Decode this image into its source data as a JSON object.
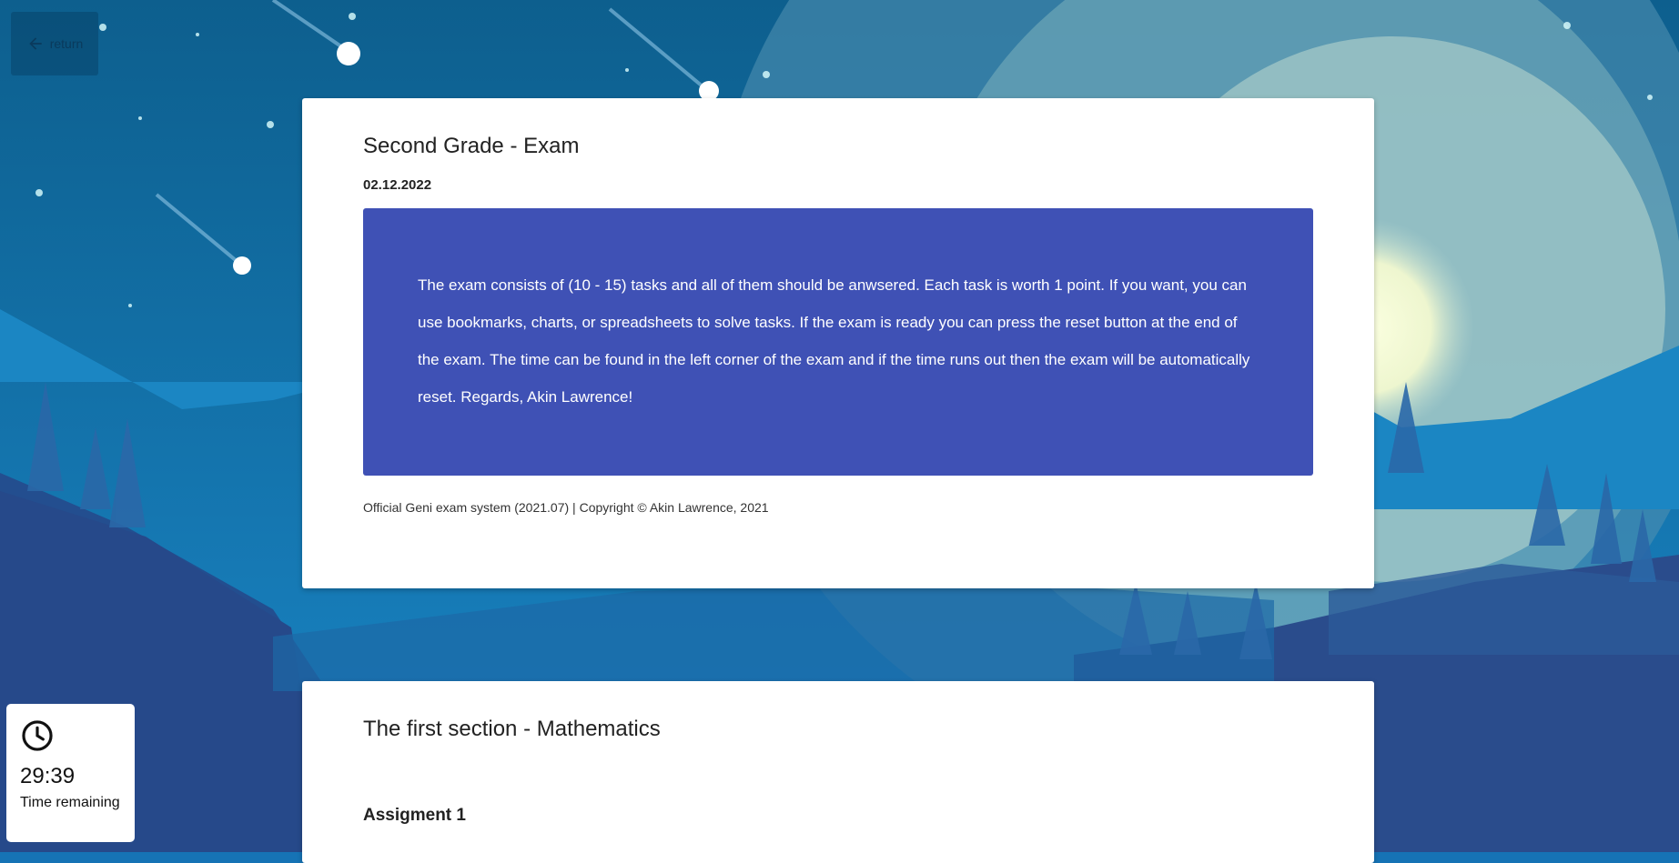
{
  "nav": {
    "return_label": "return"
  },
  "exam": {
    "title": "Second Grade - Exam",
    "date": "02.12.2022",
    "notice": "The exam consists of (10 - 15) tasks and all of them should be anwsered. Each task is worth 1 point. If you want, you can use bookmarks, charts, or spreadsheets to solve tasks. If the exam is ready you can press the reset button at the end of the exam. The time can be found in the left corner of the exam and if the time runs out then the exam will be automatically reset. Regards, Akin Lawrence!",
    "footer": "Official Geni exam system (2021.07) | Copyright © Akin Lawrence, 2021"
  },
  "section": {
    "title": "The first section - Mathematics",
    "assignment_label": "Assigment 1"
  },
  "timer": {
    "icon": "clock-icon",
    "time": "29:39",
    "label": "Time remaining"
  },
  "colors": {
    "notice_bg": "#3f51b5",
    "sky": "#1673b5",
    "moon": "#f3f7d4"
  }
}
